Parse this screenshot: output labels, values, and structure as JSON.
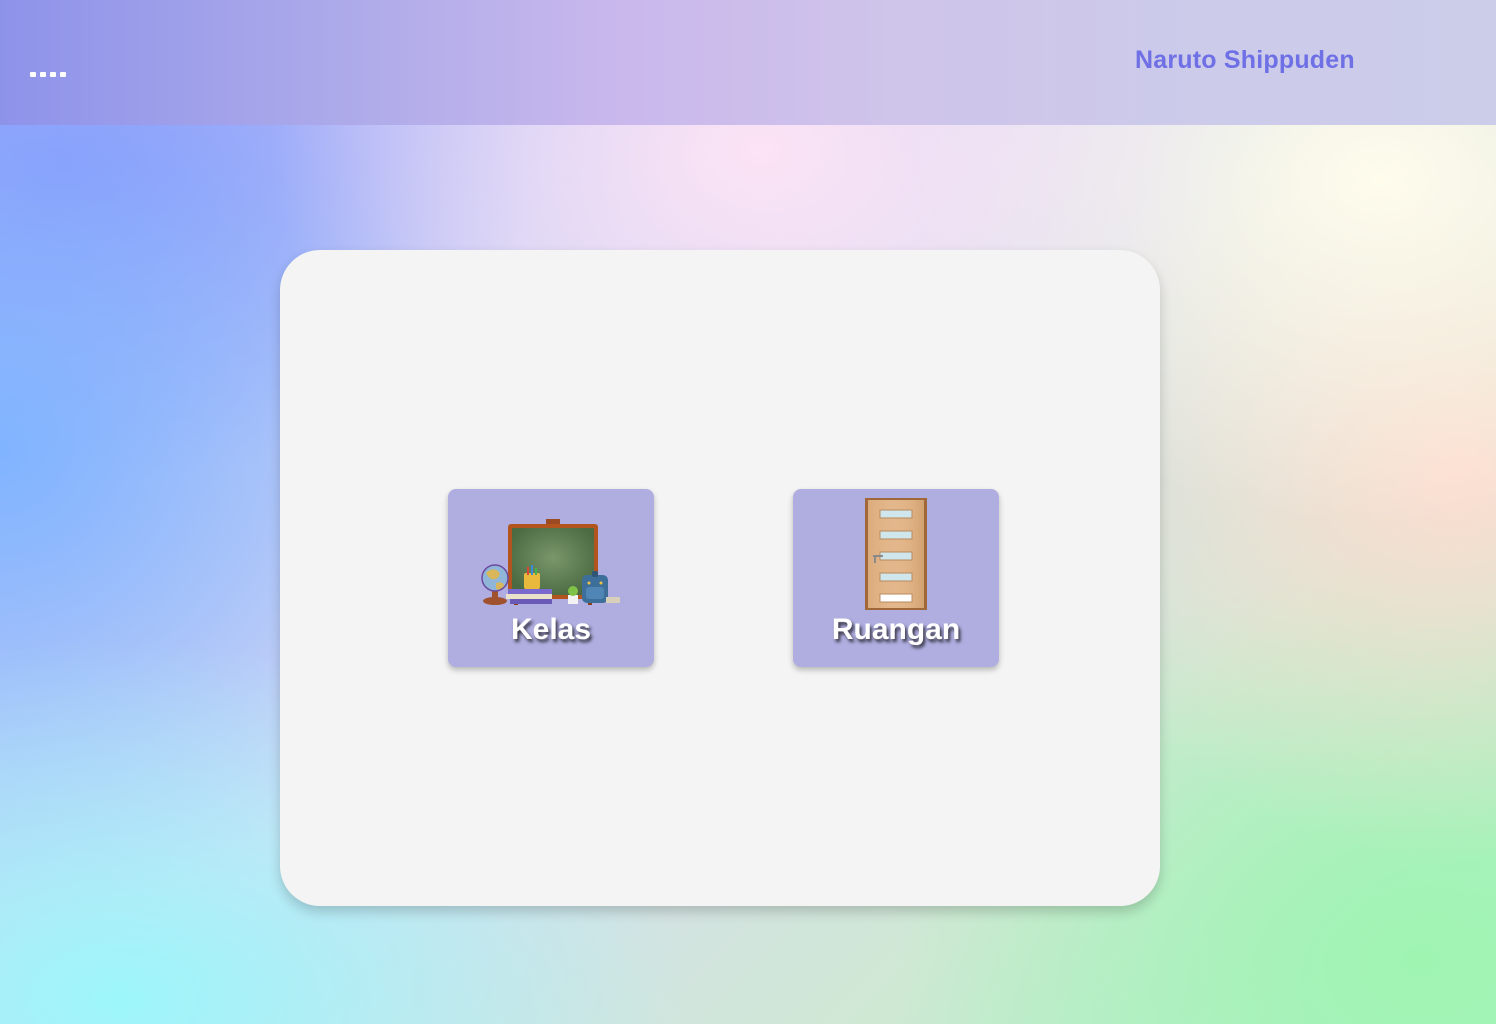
{
  "header": {
    "menu_icon": "menu-dots-icon",
    "brand": "Naruto Shippuden"
  },
  "main": {
    "tiles": [
      {
        "label": "Kelas",
        "icon": "chalkboard-icon"
      },
      {
        "label": "Ruangan",
        "icon": "door-icon"
      }
    ]
  },
  "colors": {
    "brand_text": "#6f6fe6",
    "tile_background": "#b0aee0",
    "panel_background": "#f4f4f4"
  }
}
